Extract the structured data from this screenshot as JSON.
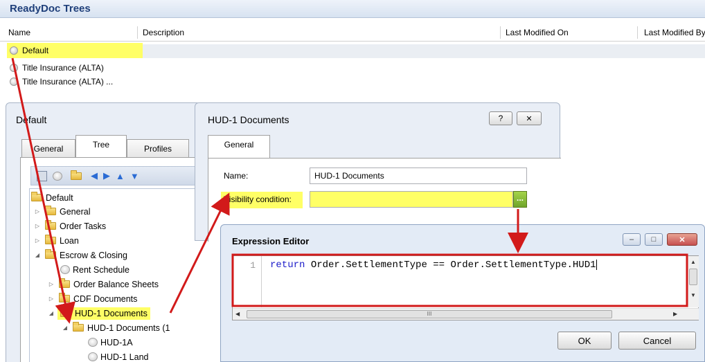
{
  "top_panel": {
    "title": "ReadyDoc Trees",
    "columns": [
      "Name",
      "Description",
      "Last Modified On",
      "Last Modified By"
    ],
    "rows": [
      "Default",
      "Title Insurance (ALTA)",
      "Title Insurance (ALTA) ..."
    ]
  },
  "default_window": {
    "title": "Default",
    "tabs": [
      "General",
      "Tree",
      "Profiles"
    ],
    "tree": [
      "Default",
      "General",
      "Order Tasks",
      "Loan",
      "Escrow & Closing",
      "Rent Schedule",
      "Order Balance Sheets",
      "CDF Documents",
      "HUD-1 Documents",
      "HUD-1 Documents (1",
      "HUD-1A",
      "HUD-1 Land"
    ]
  },
  "hud_dialog": {
    "title": "HUD-1 Documents",
    "help_btn": "?",
    "close_btn": "✕",
    "tab": "General",
    "name_label": "Name:",
    "name_value": "HUD-1 Documents",
    "visibility_label": "Visibility condition:",
    "visibility_value": "",
    "ellipsis_btn": "..."
  },
  "expression_editor": {
    "title": "Expression Editor",
    "line_number": "1",
    "code_keyword": "return",
    "code_rest": " Order.SettlementType == Order.SettlementType.HUD1",
    "scroll_marker": "III",
    "ok": "OK",
    "cancel": "Cancel",
    "minimize": "–",
    "maximize": "□",
    "close": "✕"
  },
  "colors": {
    "title_blue": "#1f3f7a",
    "highlight": "#ffff66",
    "annotation_red": "#d21a1a",
    "close_red": "#c75050"
  }
}
